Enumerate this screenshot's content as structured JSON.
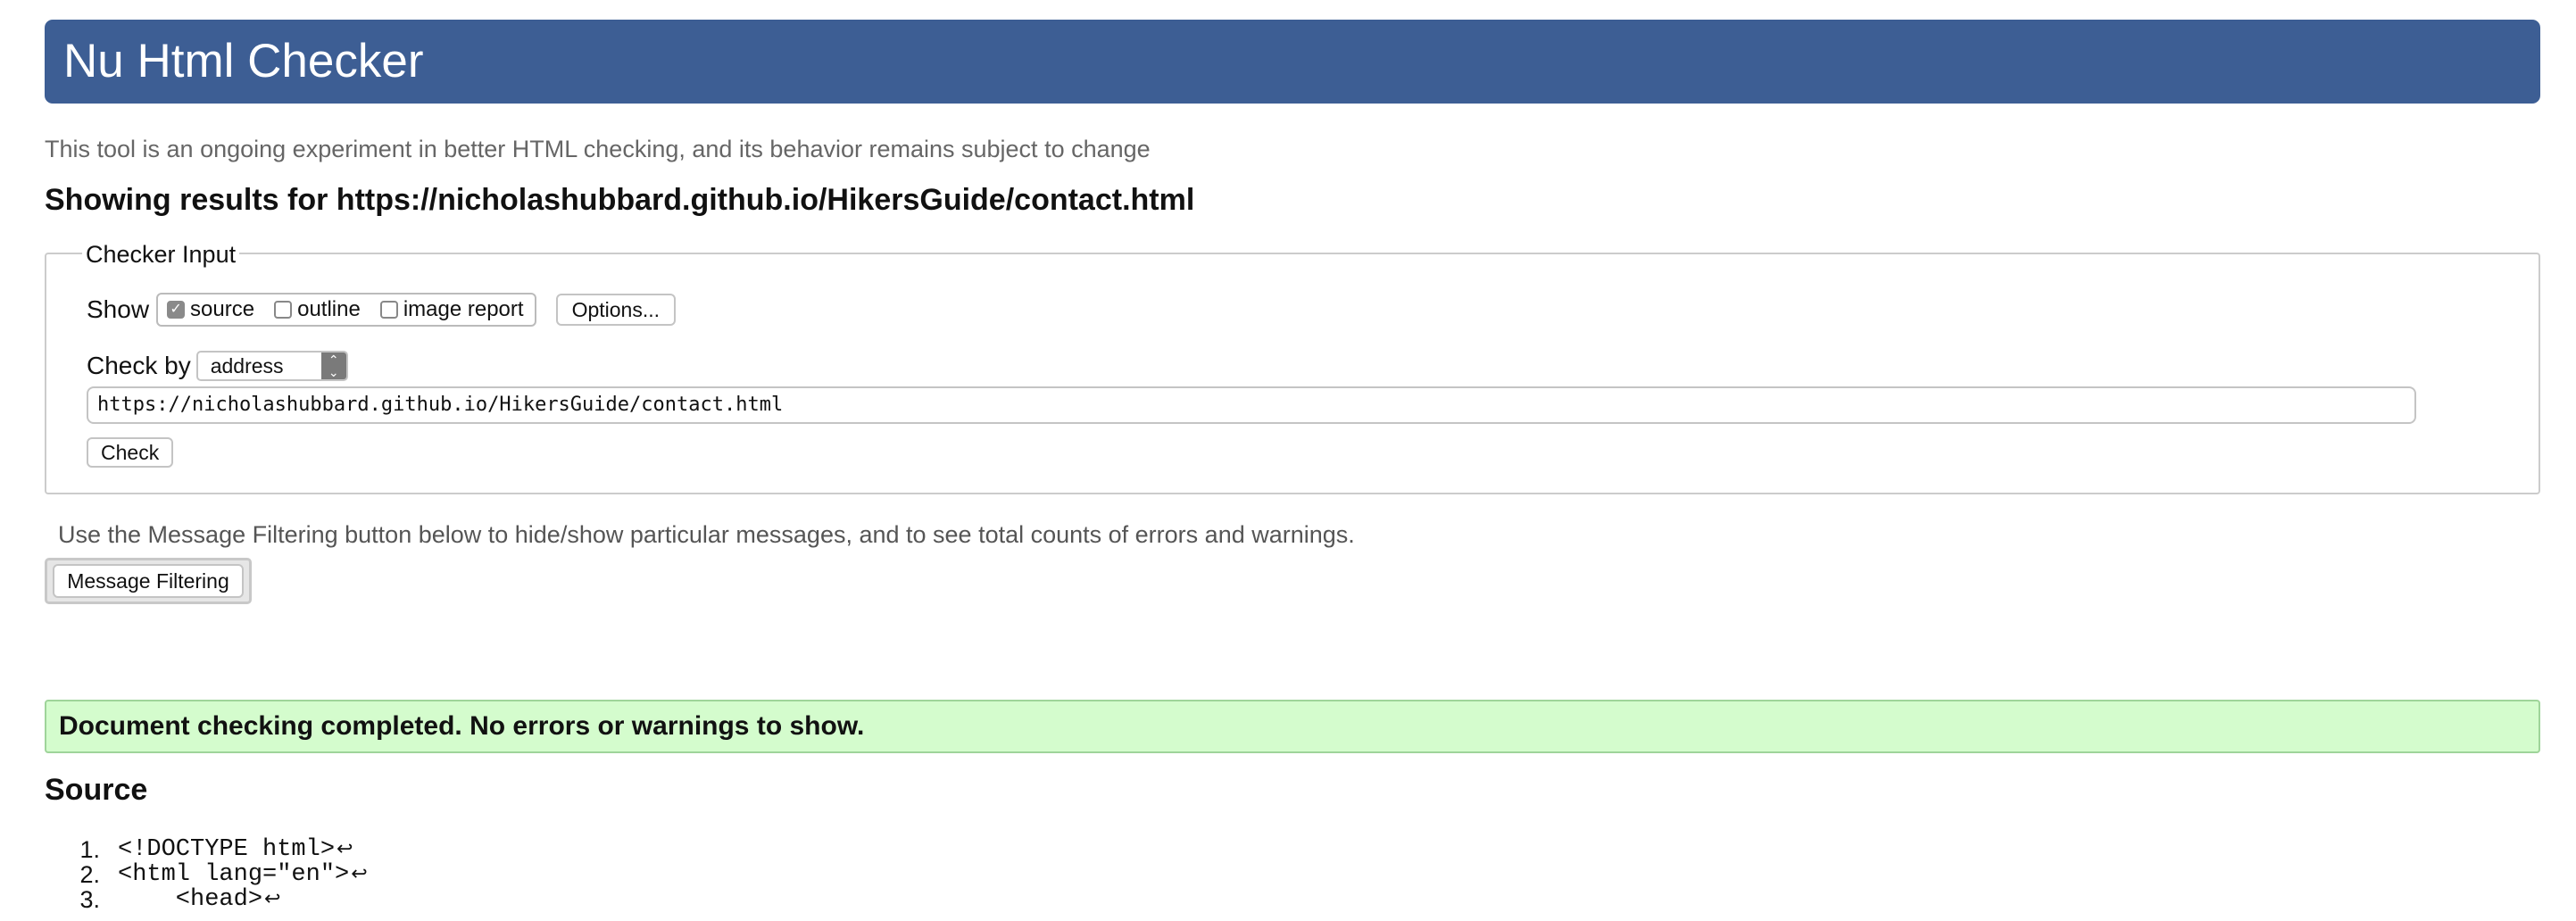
{
  "header": {
    "title": "Nu Html Checker"
  },
  "intro_text": "This tool is an ongoing experiment in better HTML checking, and its behavior remains subject to change",
  "results_heading": "Showing results for https://nicholashubbard.github.io/HikersGuide/contact.html",
  "checker_input": {
    "legend": "Checker Input",
    "show_label": "Show",
    "show_options": [
      {
        "label": "source",
        "checked": true
      },
      {
        "label": "outline",
        "checked": false
      },
      {
        "label": "image report",
        "checked": false
      }
    ],
    "options_button": "Options...",
    "check_by_label": "Check by",
    "check_by_value": "address",
    "url_value": "https://nicholashubbard.github.io/HikersGuide/contact.html",
    "check_button": "Check"
  },
  "filter": {
    "note": "Use the Message Filtering button below to hide/show particular messages, and to see total counts of errors and warnings.",
    "button": "Message Filtering"
  },
  "status": {
    "message": "Document checking completed. No errors or warnings to show.",
    "color": "#d4fccd"
  },
  "source": {
    "heading": "Source",
    "lines": [
      {
        "number": "1.",
        "code": "<!DOCTYPE html>"
      },
      {
        "number": "2.",
        "code": "<html lang=\"en\">"
      },
      {
        "number": "3.",
        "code": "    <head>"
      }
    ],
    "return_glyph": "↩"
  },
  "colors": {
    "header_bg": "#3d5e94",
    "success_bg": "#d4fccd",
    "success_border": "#9fd49a"
  }
}
